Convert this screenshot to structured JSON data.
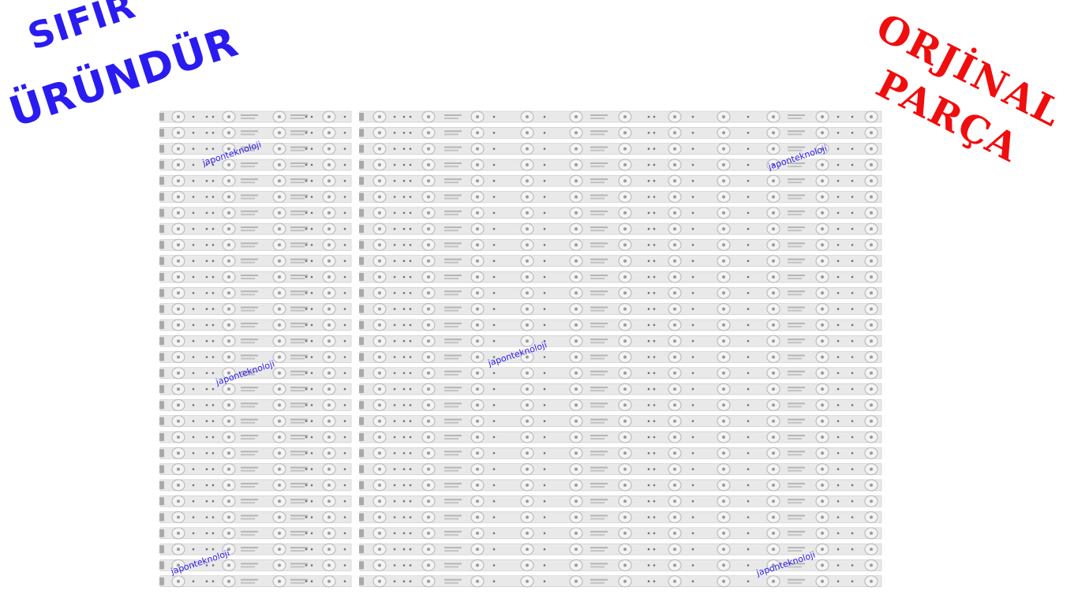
{
  "badges": {
    "new_line1": "SIFIR",
    "new_line2": "ÜRÜNDÜR",
    "original_line1": "ORJİNAL",
    "original_line2": "PARÇA"
  },
  "watermark": "japonteknoloji",
  "colors": {
    "new_badge": "#2a1cf0",
    "original_badge": "#f00d0d",
    "strip": "#e9e9e9",
    "strip_edge": "#c9c9c9",
    "lens": "#bdbdbd"
  },
  "product": {
    "short_strip_rows": 30,
    "long_strip_rows": 30
  }
}
